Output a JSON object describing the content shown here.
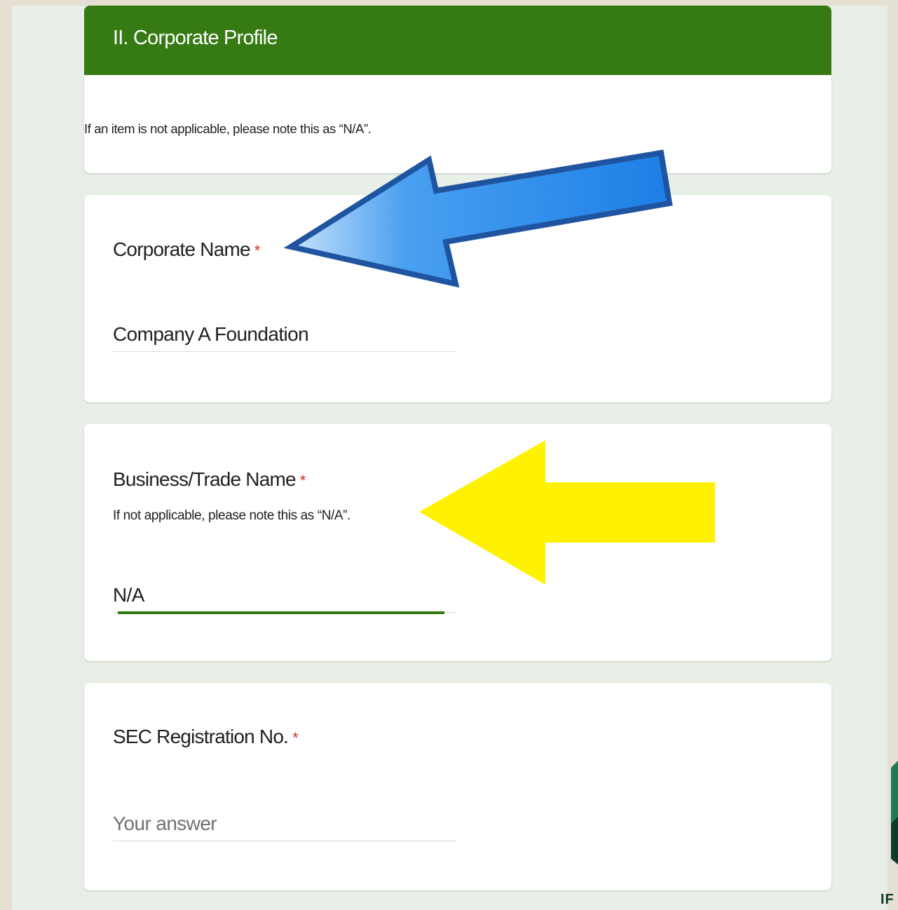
{
  "section": {
    "title": "II. Corporate Profile",
    "description": "If an item is not applicable, please note this as “N/A”."
  },
  "questions": [
    {
      "label": "Corporate Name",
      "required_mark": "*",
      "value": "Company A Foundation",
      "placeholder": ""
    },
    {
      "label": "Business/Trade Name",
      "required_mark": "*",
      "help": "If not applicable, please note this as “N/A”.",
      "value": "N/A",
      "placeholder": ""
    },
    {
      "label": "SEC Registration No.",
      "required_mark": "*",
      "value": "",
      "placeholder": "Your answer"
    }
  ],
  "theme": {
    "accent": "#367a14",
    "required": "#d93025",
    "blue_arrow": "#1a7fe8",
    "yellow_arrow": "#fff200"
  },
  "logo": {
    "letters": "IF"
  }
}
